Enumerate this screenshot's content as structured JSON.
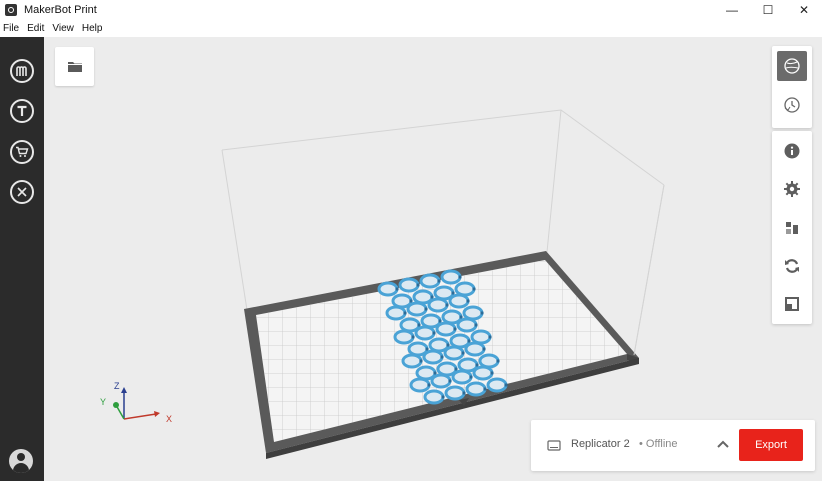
{
  "window": {
    "title": "MakerBot Print",
    "controls": {
      "minimize": "—",
      "maximize": "☐",
      "close": "✕"
    }
  },
  "menu": [
    "File",
    "Edit",
    "View",
    "Help"
  ],
  "sidebar": {
    "items": [
      {
        "name": "makerbot-logo-icon",
        "glyph": "M"
      },
      {
        "name": "thingiverse-icon",
        "glyph": "T"
      },
      {
        "name": "store-cart-icon",
        "glyph": ""
      },
      {
        "name": "utilities-icon",
        "glyph": ""
      }
    ]
  },
  "toolbar": {
    "open_file_icon": "folder-icon"
  },
  "right_tools": {
    "view_group": [
      "view-mode-icon",
      "print-preview-icon"
    ],
    "edit_group": [
      "info-icon",
      "settings-gear-icon",
      "arrange-icon",
      "rotate-icon",
      "scale-icon"
    ]
  },
  "axes": {
    "x": "X",
    "y": "Y",
    "z": "Z"
  },
  "printer": {
    "name": "Replicator 2",
    "separator": "•",
    "status": "Offline",
    "export_label": "Export"
  },
  "colors": {
    "accent": "#e8231b",
    "sidebar": "#2b2b2b",
    "viewport": "#ececec",
    "model": "#4aa3d6",
    "axis_x": "#c0392b",
    "axis_y": "#2e9e3e",
    "axis_z": "#2a3f8f"
  }
}
